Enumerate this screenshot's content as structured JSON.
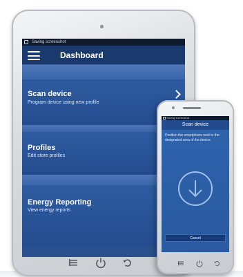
{
  "tablet": {
    "status_text": "Saving screenshot",
    "title": "Dashboard",
    "items": [
      {
        "label": "Scan device",
        "sublabel": "Program device using new profile"
      },
      {
        "label": "Profiles",
        "sublabel": "Edit store profiles"
      },
      {
        "label": "Energy Reporting",
        "sublabel": "View energy reports"
      }
    ],
    "nav_icons": [
      "menu-icon",
      "power-icon",
      "back-icon"
    ]
  },
  "phone": {
    "status_text": "Saving screenshot",
    "title": "Scan device",
    "instruction": "Position the smartphone next to the designated area of the device.",
    "cancel_label": "Cancel",
    "nav_icons": [
      "menu-icon",
      "power-icon",
      "back-icon"
    ]
  },
  "colors": {
    "screen_blue": "#2a4f8f",
    "appbar_blue": "#1a3a6e",
    "divider_blue": "#4f77b8",
    "phone_blue": "#2e63ac"
  }
}
